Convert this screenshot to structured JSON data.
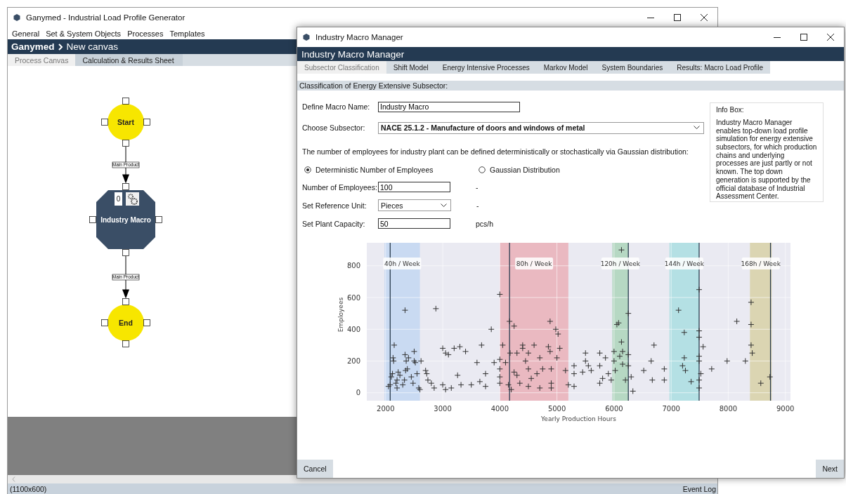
{
  "main_window": {
    "title": "Ganymed - Industrial Load Profile Generator",
    "menu": [
      "General",
      "Set & System Objects",
      "Processes",
      "Templates"
    ],
    "breadcrumb": {
      "app": "Ganymed",
      "page": "New canvas"
    },
    "tabs": [
      {
        "label": "Process Canvas",
        "selected": true
      },
      {
        "label": "Calculation & Results Sheet",
        "selected": false
      }
    ],
    "canvas": {
      "nodes": [
        {
          "kind": "start",
          "label": "Start"
        },
        {
          "kind": "macro",
          "label": "Industry Macro",
          "count": "0"
        },
        {
          "kind": "end",
          "label": "End"
        }
      ],
      "edges": [
        {
          "label": "Main Product"
        },
        {
          "label": "Main Product"
        }
      ]
    },
    "status_bar": {
      "size": "(1100x600)",
      "event_log": "Event Log"
    }
  },
  "dialog": {
    "title": "Industry Macro Manager",
    "header": "Industry Macro Manager",
    "tabs": [
      {
        "label": "Subsector Classification",
        "selected": true
      },
      {
        "label": "Shift Model",
        "selected": false
      },
      {
        "label": "Energy Intensive Processes",
        "selected": false
      },
      {
        "label": "Markov Model",
        "selected": false
      },
      {
        "label": "System Boundaries",
        "selected": false
      },
      {
        "label": "Results: Macro Load Profile",
        "selected": false
      }
    ],
    "section": "Classification of Energy Extensive Subsector:",
    "macro_name": {
      "label": "Define Macro Name:",
      "value": "Industry Macro"
    },
    "subsector": {
      "label": "Choose Subsector:",
      "value": "NACE 25.1.2 - Manufacture of doors and windows of metal"
    },
    "description": "The number of employees for industry plant can be defined deterministically or stochastically via Gaussian distribution:",
    "radios": [
      {
        "label": "Deterministic Number of Employees",
        "selected": true
      },
      {
        "label": "Gaussian Distribution",
        "selected": false
      }
    ],
    "rows": [
      {
        "kind": "input",
        "label": "Number of Employees:",
        "value": "100",
        "unit": "-"
      },
      {
        "kind": "select",
        "label": "Set Reference Unit:",
        "value": "Pieces",
        "unit": "-"
      },
      {
        "kind": "input",
        "label": "Set Plant Capacity:",
        "value": "50",
        "unit": "pcs/h"
      }
    ],
    "info_box": {
      "title": "Info Box:",
      "text": "Industry Macro Manager enables top-down load profile simulation for energy extensive subsectors, for which production chains and underlying processes are just partly or not known. The top down generation is supported by the official database of Industrial Assessment Center."
    },
    "chart_data": {
      "type": "scatter",
      "xlabel": "Yearly Production Hours",
      "ylabel": "Employees",
      "xlim": [
        1670,
        9090
      ],
      "ylim": [
        -50,
        945
      ],
      "xticks": [
        2000,
        3000,
        4000,
        5000,
        6000,
        7000,
        8000,
        9000
      ],
      "yticks": [
        0,
        200,
        400,
        600,
        800
      ],
      "series": [
        {
          "color": "#333333",
          "x": [
            2080,
            2050,
            2100,
            2120,
            2150,
            2130,
            2140,
            2200,
            2200,
            2220,
            2250,
            2180,
            2340,
            2340,
            2360,
            2400,
            2380,
            2350,
            2330,
            2300,
            2450,
            2500,
            2500,
            2520,
            2480,
            2550,
            2580,
            2620,
            2600,
            2700,
            2720,
            2740,
            2800,
            2850,
            2880,
            3000,
            3050,
            3100,
            3000,
            3050,
            3150,
            3200,
            3260,
            3300,
            3320,
            3400,
            3500,
            3600,
            3650,
            3680,
            3750,
            3750,
            3850,
            3900,
            4000,
            4000,
            4000,
            4000,
            4000,
            4050,
            4100,
            4170,
            4180,
            4150,
            4200,
            4250,
            4250,
            4300,
            4300,
            4400,
            4400,
            4350,
            4450,
            4500,
            4500,
            4500,
            4550,
            4600,
            4650,
            4700,
            4700,
            4750,
            4850,
            4880,
            4880,
            4900,
            4900,
            4900,
            4980,
            5020,
            5000,
            5050,
            5150,
            5200,
            5300,
            5300,
            5300,
            5450,
            5500,
            5500,
            5550,
            5600,
            5750,
            5750,
            5750,
            5800,
            5850,
            5900,
            5950,
            6000,
            6000,
            6020,
            6050,
            6080,
            6100,
            6130,
            6130,
            6150,
            6150,
            6200,
            6250,
            6250,
            6250,
            6300,
            6330,
            6520,
            6650,
            6670,
            6700,
            6880,
            6880,
            7130,
            7200,
            7230,
            7230,
            7250,
            7350,
            7490,
            7490,
            7490,
            7490,
            7490,
            7490,
            7490,
            7520,
            7560,
            7710,
            7980,
            8150,
            8300,
            8400,
            8400,
            8400,
            8420,
            8570,
            8730
          ],
          "values": [
            50,
            40,
            100,
            120,
            300,
            220,
            200,
            30,
            80,
            130,
            110,
            60,
            520,
            240,
            200,
            220,
            150,
            140,
            80,
            50,
            100,
            260,
            200,
            190,
            60,
            120,
            30,
            200,
            20,
            140,
            120,
            80,
            60,
            30,
            530,
            280,
            250,
            240,
            50,
            20,
            30,
            280,
            110,
            290,
            50,
            260,
            50,
            190,
            70,
            300,
            120,
            40,
            400,
            190,
            620,
            210,
            150,
            100,
            60,
            300,
            190,
            450,
            250,
            50,
            20,
            420,
            130,
            250,
            110,
            300,
            280,
            60,
            200,
            250,
            150,
            40,
            90,
            300,
            120,
            220,
            30,
            150,
            290,
            450,
            260,
            150,
            60,
            30,
            400,
            370,
            220,
            280,
            140,
            50,
            170,
            120,
            40,
            130,
            250,
            200,
            170,
            140,
            250,
            170,
            60,
            90,
            220,
            120,
            80,
            260,
            200,
            140,
            430,
            440,
            230,
            900,
            320,
            260,
            180,
            80,
            500,
            240,
            170,
            100,
            10,
            140,
            200,
            80,
            300,
            150,
            80,
            520,
            170,
            380,
            220,
            140,
            70,
            650,
            390,
            350,
            230,
            200,
            80,
            30,
            120,
            290,
            150,
            200,
            450,
            200,
            570,
            430,
            300,
            250,
            60,
            100
          ]
        }
      ],
      "grid": true,
      "bands": [
        {
          "axis": "x",
          "from": 1980,
          "to": 2600,
          "color": "#c9daf2"
        },
        {
          "axis": "x",
          "from": 4000,
          "to": 5200,
          "color": "#eab9c1"
        },
        {
          "axis": "x",
          "from": 5970,
          "to": 6250,
          "color": "#b6d8c3"
        },
        {
          "axis": "x",
          "from": 6970,
          "to": 7490,
          "color": "#b4e0e4"
        },
        {
          "axis": "x",
          "from": 8380,
          "to": 8760,
          "color": "#dbd5b2"
        }
      ],
      "ref_lines": [
        {
          "axis": "x",
          "value": 2080
        },
        {
          "axis": "x",
          "value": 4170
        },
        {
          "axis": "x",
          "value": 6250
        },
        {
          "axis": "x",
          "value": 7490
        },
        {
          "axis": "x",
          "value": 8740
        }
      ],
      "annotations": [
        "40h / Week",
        "80h / Week",
        "120h / Week",
        "144h / Week",
        "168h / Week"
      ]
    },
    "buttons": {
      "cancel": "Cancel",
      "next": "Next"
    }
  }
}
